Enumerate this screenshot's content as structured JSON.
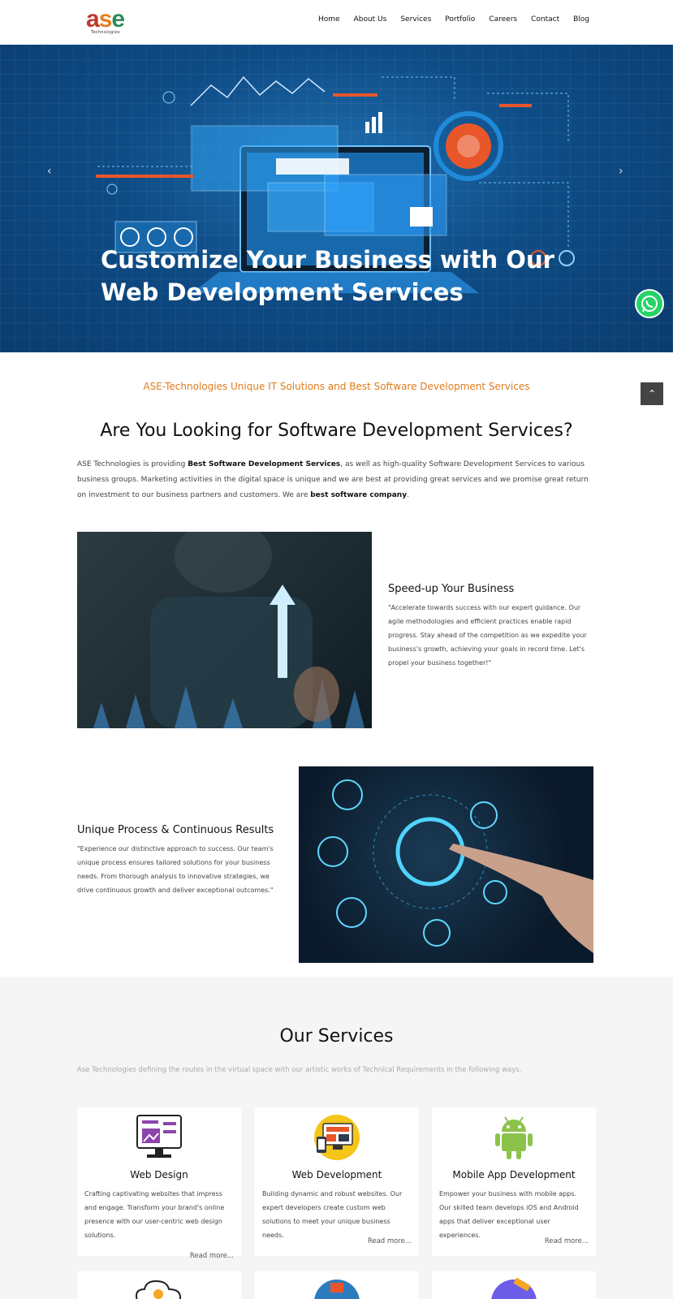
{
  "brand": {
    "logo_text": "ase",
    "tagline": "Technologies"
  },
  "nav": {
    "items": [
      "Home",
      "About Us",
      "Services",
      "Portfolio",
      "Careers",
      "Contact",
      "Blog"
    ]
  },
  "hero": {
    "title_line1": "Customize Your Business with Our",
    "title_line2": "Web Development Services",
    "prev_label": "‹",
    "next_label": "›"
  },
  "widgets": {
    "back_to_top": "⌃"
  },
  "intro": {
    "kicker": "ASE-Technologies Unique IT Solutions and Best Software Development Services",
    "heading": "Are You Looking for Software Development Services?",
    "p_part1": "ASE Technologies is providing ",
    "p_bold1": "Best Software Development Services",
    "p_part2": ", as well as high-quality Software Development Services to various business groups. Marketing activities in the digital space is unique and we are best at providing great services and we promise great return on investment to our business partners and customers. We are ",
    "p_bold2": "best software company",
    "p_part3": "."
  },
  "features": [
    {
      "title": "Speed-up Your Business",
      "text": "\"Accelerate towards success with our expert guidance. Our agile methodologies and efficient practices enable rapid progress. Stay ahead of the competition as we expedite your business's growth, achieving your goals in record time. Let's propel your business together!\""
    },
    {
      "title": "Unique Process & Continuous Results",
      "text": "\"Experience our distinctive approach to success. Our team's unique process ensures tailored solutions for your business needs. From thorough analysis to innovative strategies, we drive continuous growth and deliver exceptional outcomes.\""
    }
  ],
  "services": {
    "heading": "Our Services",
    "subtitle": "Ase Technologies defining the routes in the virtual space with our artistic works of Technical Requirements in the following ways.",
    "read_more": "Read more...",
    "cards": [
      {
        "title": "Web Design",
        "icon": "monitor-design-icon",
        "text": "Crafting captivating websites that impress and engage. Transform your brand's online presence with our user-centric web design solutions."
      },
      {
        "title": "Web Development",
        "icon": "web-development-icon",
        "text": "Building dynamic and robust websites. Our expert developers create custom web solutions to meet your unique business needs."
      },
      {
        "title": "Mobile App Development",
        "icon": "android-icon",
        "text": "Empower your business with mobile apps. Our skilled team develops iOS and Android apps that deliver exceptional user experiences."
      }
    ]
  },
  "colors": {
    "accent_orange": "#e07b1a",
    "hero_blue": "#0e4c86",
    "whatsapp_green": "#25d366",
    "android_green": "#8bc34a"
  }
}
